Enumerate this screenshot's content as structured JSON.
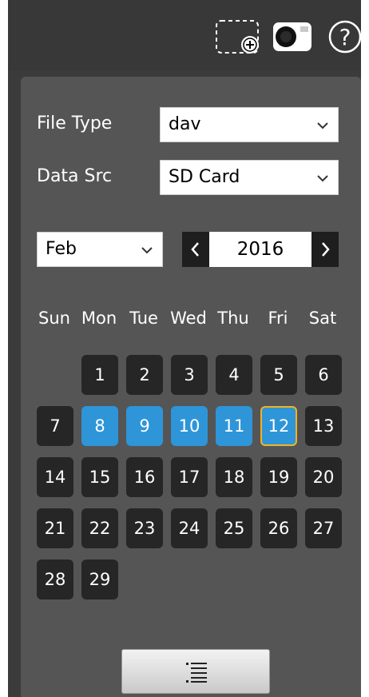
{
  "toolbar": {
    "icons": [
      "add-window-icon",
      "snapshot-camera-icon",
      "help-icon"
    ]
  },
  "file_type": {
    "label": "File Type",
    "value": "dav"
  },
  "data_src": {
    "label": "Data Src",
    "value": "SD Card"
  },
  "calendar": {
    "month": "Feb",
    "year": "2016",
    "weekdays": [
      "Sun",
      "Mon",
      "Tue",
      "Wed",
      "Thu",
      "Fri",
      "Sat"
    ],
    "days": [
      "1",
      "2",
      "3",
      "4",
      "5",
      "6",
      "7",
      "8",
      "9",
      "10",
      "11",
      "12",
      "13",
      "14",
      "15",
      "16",
      "17",
      "18",
      "19",
      "20",
      "21",
      "22",
      "23",
      "24",
      "25",
      "26",
      "27",
      "28",
      "29"
    ],
    "first_weekday_index": 1,
    "selected_days": [
      "8",
      "9",
      "10",
      "11"
    ],
    "today": "12"
  },
  "actions": {
    "list_icon": "list-icon"
  },
  "colors": {
    "selected_day": "#2e95d8",
    "today_border": "#f0b323",
    "day_cell": "#262626",
    "panel": "#555555",
    "toolbar": "#383838"
  }
}
